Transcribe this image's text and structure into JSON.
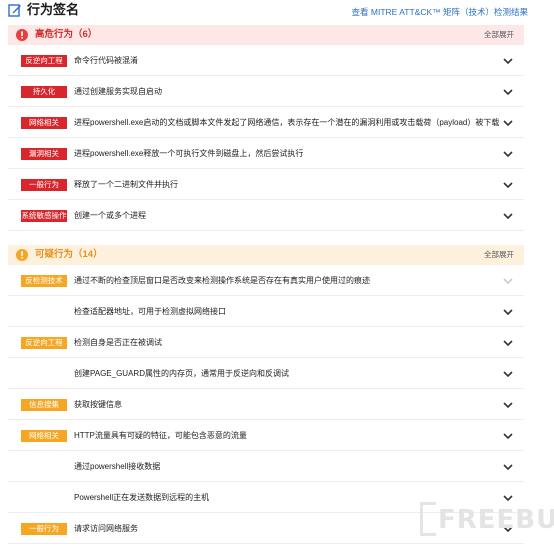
{
  "header": {
    "title": "行为签名",
    "mitre_link": "查看 MITRE ATT&CK™ 矩阵（技术）检测结果"
  },
  "high_risk": {
    "title": "高危行为（6）",
    "expand_label": "全部展开",
    "rows": [
      {
        "tag": "反逆向工程",
        "desc": "命令行代码被混淆"
      },
      {
        "tag": "持久化",
        "desc": "通过创建服务实现自启动"
      },
      {
        "tag": "网络相关",
        "desc": "进程powershell.exe启动的文档或脚本文件发起了网络通信，表示存在一个潜在的漏洞利用或攻击载荷（payload）被下载"
      },
      {
        "tag": "漏洞相关",
        "desc": "进程powershell.exe释放一个可执行文件到磁盘上，然后尝试执行"
      },
      {
        "tag": "一般行为",
        "desc": "释放了一个二进制文件并执行"
      },
      {
        "tag": "系统敏感操作",
        "desc": "创建一个或多个进程"
      }
    ]
  },
  "suspicious": {
    "title": "可疑行为（14）",
    "expand_label": "全部展开",
    "rows": [
      {
        "tag": "反检测技术",
        "desc": "通过不断的检查顶层窗口是否改变来检测操作系统是否存在有真实用户使用过的痕迹"
      },
      {
        "tag": "",
        "desc": "检查适配器地址，可用于检测虚拟网络接口"
      },
      {
        "tag": "反逆向工程",
        "desc": "检测自身是否正在被调试"
      },
      {
        "tag": "",
        "desc": "创建PAGE_GUARD属性的内存页，通常用于反逆向和反调试"
      },
      {
        "tag": "信息搜集",
        "desc": "获取按键信息"
      },
      {
        "tag": "网络相关",
        "desc": "HTTP流量具有可疑的特征，可能包含恶意的流量"
      },
      {
        "tag": "",
        "desc": "通过powershell接收数据"
      },
      {
        "tag": "",
        "desc": "Powershell正在发送数据到远程的主机"
      },
      {
        "tag": "一般行为",
        "desc": "请求访问网络服务"
      }
    ]
  },
  "watermark": "FREEBUF",
  "colors": {
    "high_tag": "#d9262d",
    "susp_tag": "#f5a623",
    "high_bg": "#fde7e7",
    "susp_bg": "#fdf1dd",
    "link": "#2d6fc9"
  },
  "icons": {
    "header": "edit-icon",
    "high_section": "alert-circle-icon",
    "susp_section": "alert-circle-icon",
    "row_toggle": "chevron-down-icon"
  }
}
